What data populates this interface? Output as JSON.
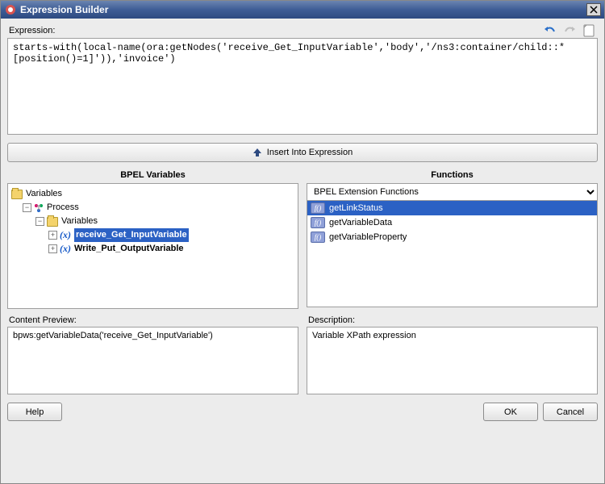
{
  "window": {
    "title": "Expression Builder"
  },
  "labels": {
    "expression": "Expression:",
    "insert": "Insert Into Expression",
    "bpel_vars": "BPEL Variables",
    "functions": "Functions",
    "content_preview": "Content Preview:",
    "description": "Description:"
  },
  "expression_text": "starts-with(local-name(ora:getNodes('receive_Get_InputVariable','body','/ns3:container/child::*[position()=1]')),'invoice')",
  "tree": {
    "root": "Variables",
    "process": "Process",
    "vars_node": "Variables",
    "items": [
      {
        "name": "receive_Get_InputVariable",
        "selected": true
      },
      {
        "name": "Write_Put_OutputVariable",
        "selected": false
      }
    ]
  },
  "functions": {
    "category": "BPEL Extension Functions",
    "items": [
      {
        "name": "getLinkStatus",
        "selected": true
      },
      {
        "name": "getVariableData",
        "selected": false
      },
      {
        "name": "getVariableProperty",
        "selected": false
      }
    ]
  },
  "content_preview": "bpws:getVariableData('receive_Get_InputVariable')",
  "description": "Variable XPath expression",
  "buttons": {
    "help": "Help",
    "ok": "OK",
    "cancel": "Cancel"
  },
  "icons": {
    "fn_badge": "f()",
    "var_marker": "(x)"
  }
}
